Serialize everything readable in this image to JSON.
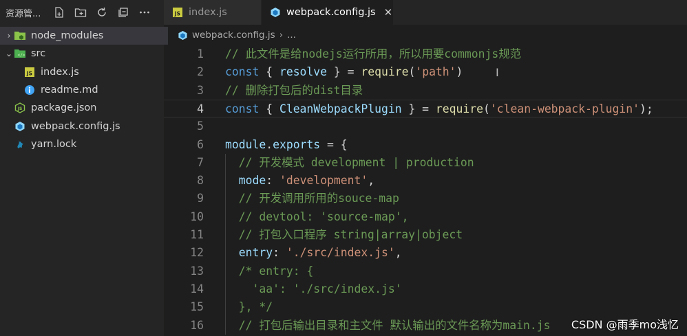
{
  "sidebar": {
    "title": "资源管...",
    "actions": [
      {
        "icon": "new-file-icon"
      },
      {
        "icon": "new-folder-icon"
      },
      {
        "icon": "refresh-icon"
      },
      {
        "icon": "collapse-all-icon"
      },
      {
        "icon": "more-actions-icon"
      }
    ],
    "tree": [
      {
        "label": "node_modules",
        "chevron": "›",
        "icon": "folder-node-icon",
        "indent": 0,
        "selected": true
      },
      {
        "label": "src",
        "chevron": "⌄",
        "icon": "folder-src-icon",
        "indent": 0,
        "selected": false
      },
      {
        "label": "index.js",
        "chevron": "",
        "icon": "js-file-icon",
        "indent": 1,
        "selected": false
      },
      {
        "label": "readme.md",
        "chevron": "",
        "icon": "info-file-icon",
        "indent": 1,
        "selected": false
      },
      {
        "label": "package.json",
        "chevron": "",
        "icon": "nodejs-file-icon",
        "indent": 0,
        "selected": false
      },
      {
        "label": "webpack.config.js",
        "chevron": "",
        "icon": "webpack-file-icon",
        "indent": 0,
        "selected": false
      },
      {
        "label": "yarn.lock",
        "chevron": "",
        "icon": "yarn-file-icon",
        "indent": 0,
        "selected": false
      }
    ]
  },
  "tabs": [
    {
      "label": "index.js",
      "icon": "js-file-icon",
      "active": false
    },
    {
      "label": "webpack.config.js",
      "icon": "webpack-file-icon",
      "active": true,
      "close": "✕"
    }
  ],
  "breadcrumb": {
    "file": "webpack.config.js",
    "sep": "›",
    "more": "..."
  },
  "editor": {
    "current_line": 4,
    "lines": [
      {
        "n": "1",
        "indent": "",
        "tokens": [
          [
            "comment",
            "// 此文件是给nodejs运行所用，所以用要commonjs规范"
          ]
        ]
      },
      {
        "n": "2",
        "indent": "",
        "tokens": [
          [
            "keyword",
            "const"
          ],
          [
            "punc",
            " { "
          ],
          [
            "var",
            "resolve"
          ],
          [
            "punc",
            " } = "
          ],
          [
            "func",
            "require"
          ],
          [
            "punc",
            "("
          ],
          [
            "string",
            "'path'"
          ],
          [
            "punc",
            ")"
          ]
        ]
      },
      {
        "n": "3",
        "indent": "",
        "tokens": [
          [
            "comment",
            "// 删除打包后的dist目录"
          ]
        ]
      },
      {
        "n": "4",
        "indent": "",
        "tokens": [
          [
            "keyword",
            "const"
          ],
          [
            "punc",
            " { "
          ],
          [
            "var",
            "CleanWebpackPlugin"
          ],
          [
            "punc",
            " } = "
          ],
          [
            "func",
            "require"
          ],
          [
            "punc",
            "("
          ],
          [
            "string",
            "'clean-webpack-plugin'"
          ],
          [
            "punc",
            ");"
          ]
        ]
      },
      {
        "n": "5",
        "indent": "",
        "tokens": []
      },
      {
        "n": "6",
        "indent": "",
        "tokens": [
          [
            "var",
            "module"
          ],
          [
            "punc",
            "."
          ],
          [
            "var",
            "exports"
          ],
          [
            "punc",
            " = {"
          ]
        ]
      },
      {
        "n": "7",
        "indent": "  ",
        "tokens": [
          [
            "comment",
            "// 开发模式 development | production"
          ]
        ]
      },
      {
        "n": "8",
        "indent": "  ",
        "tokens": [
          [
            "var",
            "mode"
          ],
          [
            "punc",
            ": "
          ],
          [
            "string",
            "'development'"
          ],
          [
            "punc",
            ","
          ]
        ]
      },
      {
        "n": "9",
        "indent": "  ",
        "tokens": [
          [
            "comment",
            "// 开发调用所用的souce-map"
          ]
        ]
      },
      {
        "n": "10",
        "indent": "  ",
        "tokens": [
          [
            "comment",
            "// devtool: 'source-map',"
          ]
        ]
      },
      {
        "n": "11",
        "indent": "  ",
        "tokens": [
          [
            "comment",
            "// 打包入口程序 string|array|object"
          ]
        ]
      },
      {
        "n": "12",
        "indent": "  ",
        "tokens": [
          [
            "var",
            "entry"
          ],
          [
            "punc",
            ": "
          ],
          [
            "string",
            "'./src/index.js'"
          ],
          [
            "punc",
            ","
          ]
        ]
      },
      {
        "n": "13",
        "indent": "  ",
        "tokens": [
          [
            "comment",
            "/* entry: {"
          ]
        ]
      },
      {
        "n": "14",
        "indent": "    ",
        "tokens": [
          [
            "comment",
            "'aa': './src/index.js'"
          ]
        ]
      },
      {
        "n": "15",
        "indent": "  ",
        "tokens": [
          [
            "comment",
            "}, */"
          ]
        ]
      },
      {
        "n": "16",
        "indent": "  ",
        "tokens": [
          [
            "comment",
            "// 打包后输出目录和主文件 默认输出的文件名称为main.js"
          ]
        ]
      }
    ]
  },
  "watermark": "CSDN @雨季mo浅忆",
  "colors": {
    "comment": "#6a9955",
    "keyword": "#569cd6",
    "string": "#ce9178",
    "variable": "#9cdcfe",
    "function": "#dcdcaa"
  }
}
